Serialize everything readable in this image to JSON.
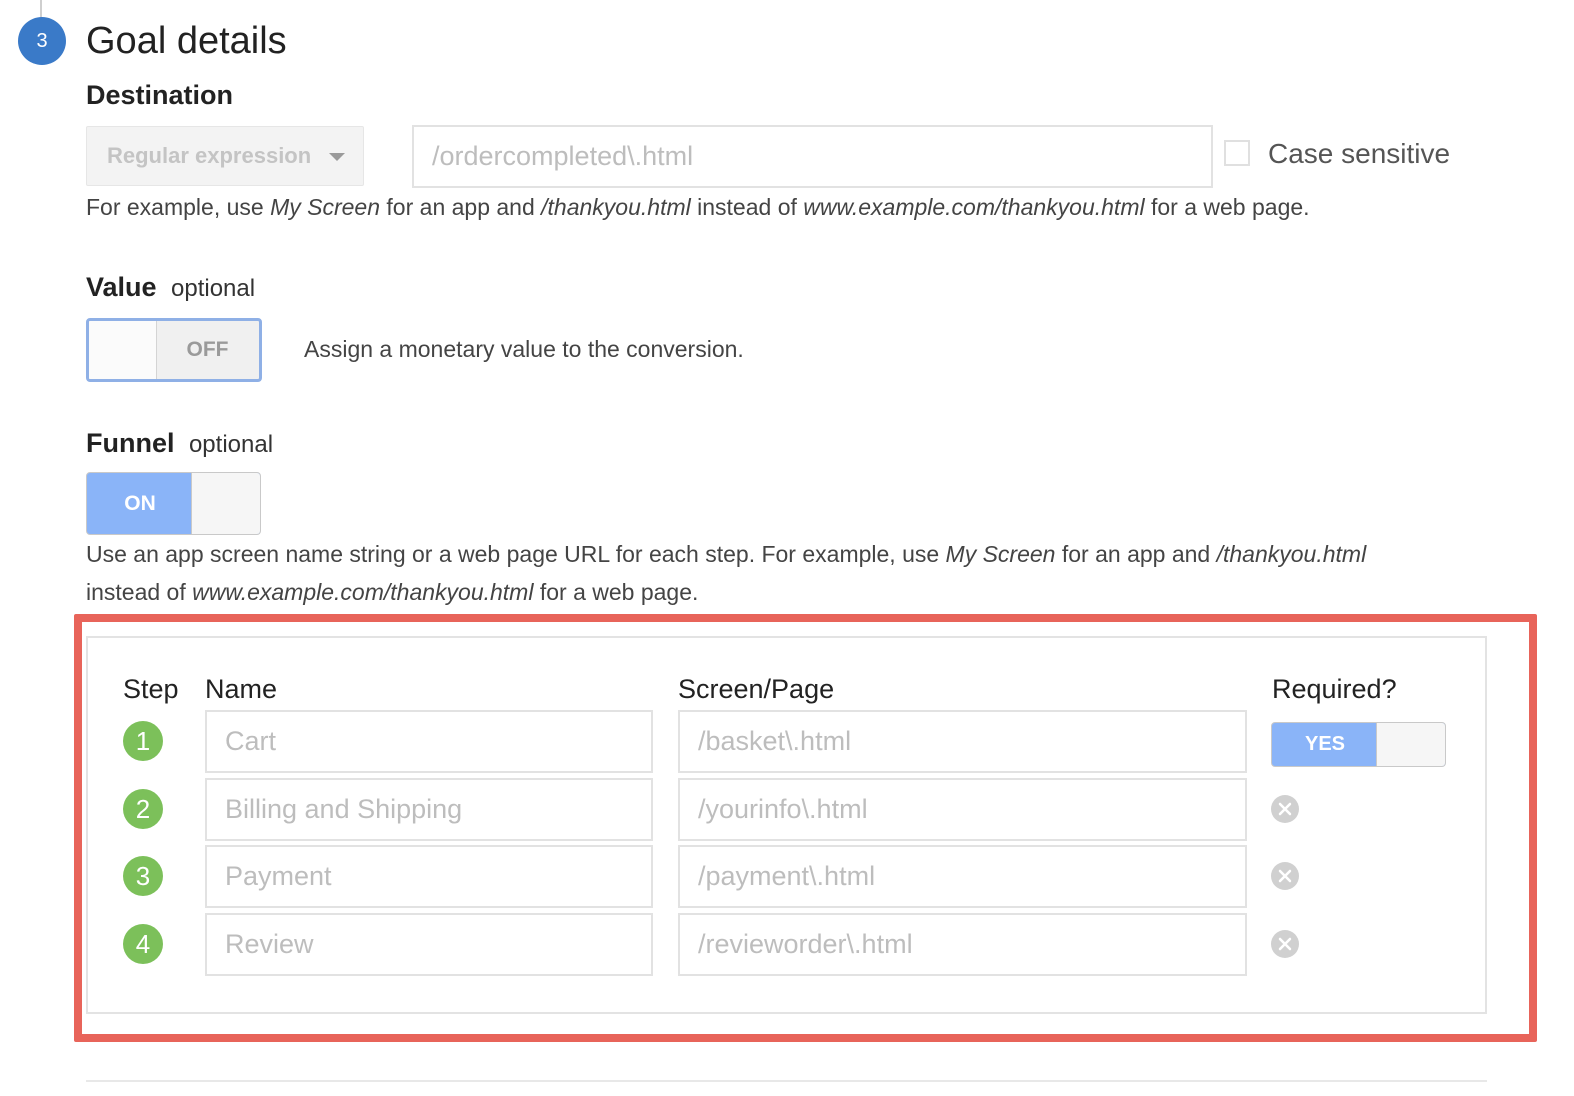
{
  "section": {
    "step_number": "3",
    "title": "Goal details"
  },
  "destination": {
    "label": "Destination",
    "match_type": "Regular expression",
    "value": "/ordercompleted\\.html",
    "case_sensitive_label": "Case sensitive",
    "case_sensitive_checked": false,
    "help": {
      "t1": "For example, use ",
      "i1": "My Screen",
      "t2": " for an app and ",
      "i2": "/thankyou.html",
      "t3": " instead of ",
      "i3": "www.example.com/thankyou.html",
      "t4": " for a web page."
    }
  },
  "value_section": {
    "label": "Value",
    "optional": "optional",
    "toggle_state": "OFF",
    "description": "Assign a monetary value to the conversion."
  },
  "funnel": {
    "label": "Funnel",
    "optional": "optional",
    "toggle_state": "ON",
    "help": {
      "t1": "Use an app screen name string or a web page URL for each step. For example, use ",
      "i1": "My Screen",
      "t2": " for an app and ",
      "i2": "/thankyou.html",
      "t3": "instead of ",
      "i3": "www.example.com/thankyou.html",
      "t4": " for a web page."
    },
    "headers": {
      "step": "Step",
      "name": "Name",
      "screen": "Screen/Page",
      "required": "Required?"
    },
    "required_toggle": "YES",
    "steps": [
      {
        "number": "1",
        "name": "Cart",
        "screen": "/basket\\.html"
      },
      {
        "number": "2",
        "name": "Billing and Shipping",
        "screen": "/yourinfo\\.html"
      },
      {
        "number": "3",
        "name": "Payment",
        "screen": "/payment\\.html"
      },
      {
        "number": "4",
        "name": "Review",
        "screen": "/revieworder\\.html"
      }
    ]
  },
  "colors": {
    "badge_blue": "#3a7ac8",
    "toggle_on_blue": "#8ab4f8",
    "step_green": "#7cc05a",
    "highlight_red": "#e8645a"
  }
}
